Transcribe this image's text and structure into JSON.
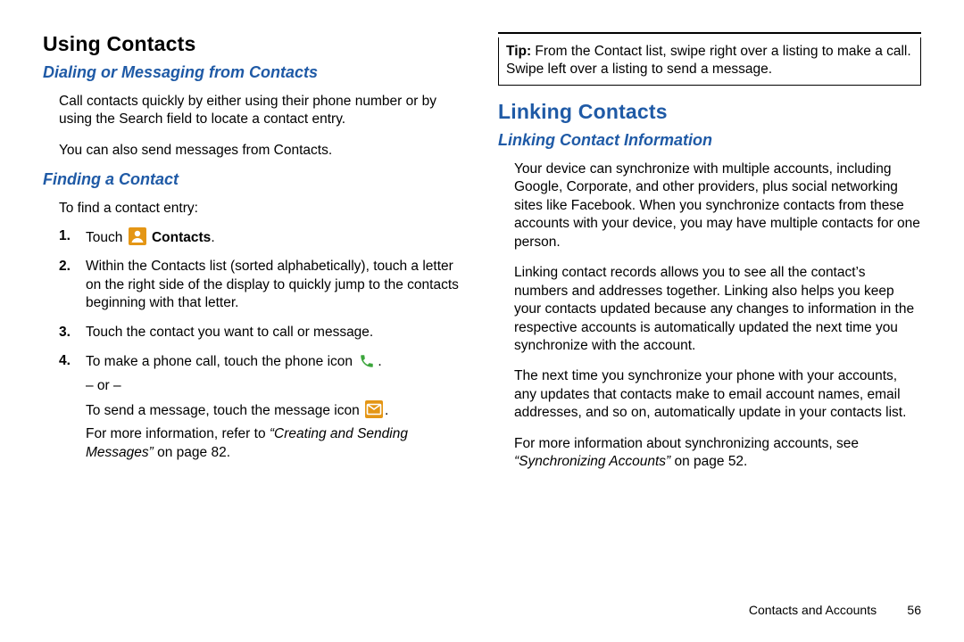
{
  "left": {
    "h1": "Using Contacts",
    "h2a": "Dialing or Messaging from Contacts",
    "p1": "Call contacts quickly by either using their phone number or by using the Search field to locate a contact entry.",
    "p2": "You can also send messages from Contacts.",
    "h2b": "Finding a Contact",
    "intro": "To find a contact entry:",
    "step1_touch": "Touch ",
    "step1_contacts": "Contacts",
    "step1_period": ".",
    "step2": "Within the Contacts list (sorted alphabetically), touch a letter on the right side of the display to quickly jump to the contacts beginning with that letter.",
    "step3": "Touch the contact you want to call or message.",
    "step4_a": "To make a phone call, touch the phone icon ",
    "step4_a_end": ".",
    "step4_or": "– or –",
    "step4_b": "To send a message, touch the message icon ",
    "step4_b_end": ".",
    "step4_c_pre": "For more information, refer to ",
    "step4_c_ref": "“Creating and Sending Messages”",
    "step4_c_post": " on page 82."
  },
  "right": {
    "tip_label": "Tip:",
    "tip_text": " From the Contact list, swipe right over a listing to make a call. Swipe left over a listing to send a message.",
    "h1": "Linking Contacts",
    "h2": "Linking Contact Information",
    "p1": "Your device can synchronize with multiple accounts, including Google, Corporate, and other providers, plus social networking sites like Facebook. When you synchronize contacts from these accounts with your device, you may have multiple contacts for one person.",
    "p2": "Linking contact records allows you to see all the contact’s numbers and addresses together. Linking also helps you keep your contacts updated because any changes to information in the respective accounts is automatically updated the next time you synchronize with the account.",
    "p3": "The next time you synchronize your phone with your accounts, any updates that contacts make to email account names, email addresses, and so on, automatically update in your contacts list.",
    "p4_pre": "For more information about synchronizing accounts, see ",
    "p4_ref": "“Synchronizing Accounts”",
    "p4_post": " on page 52.",
    "footer_section": "Contacts and Accounts",
    "footer_page": "56"
  }
}
